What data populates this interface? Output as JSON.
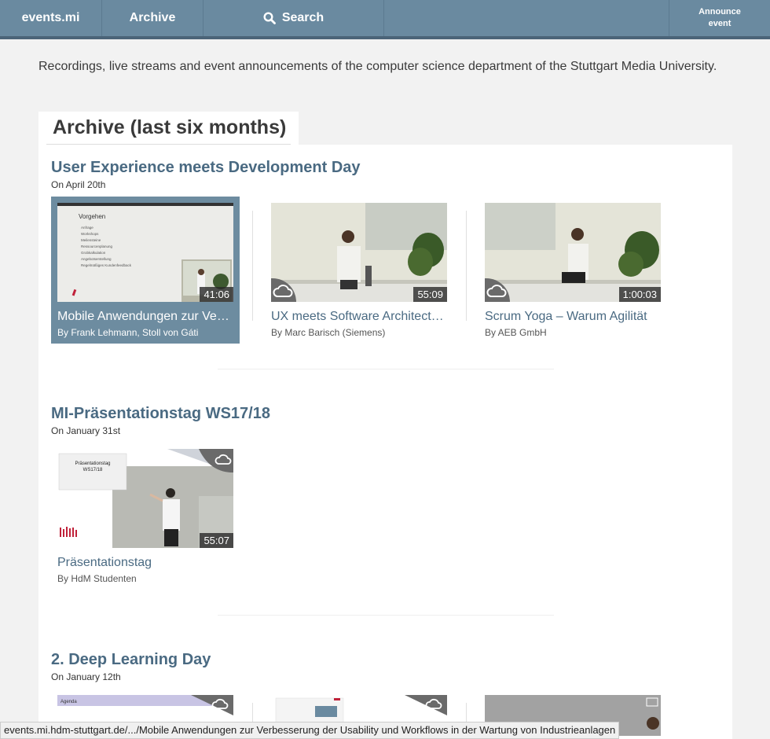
{
  "nav": {
    "brand": "events.mi",
    "archive": "Archive",
    "search": "Search",
    "announce_line1": "Announce",
    "announce_line2": "event"
  },
  "intro": "Recordings, live streams and event announcements of the computer science department of the Stuttgart Media University.",
  "archive_heading": "Archive (last six months)",
  "events": [
    {
      "title": "User Experience meets Development Day",
      "date": "On April 20th",
      "videos": [
        {
          "title": "Mobile Anwendungen zur Verbesserung der Usability und Workflows in der Wartung von Industrieanlagen",
          "by": "By Frank Lehmann, Stoll von Gáti",
          "duration": "41:06",
          "slide_title": "Vorgehen",
          "slide_bullets": [
            "Anfrage",
            "Workshops",
            "Meilensteine",
            "Ressourcenplanung",
            "Grobkalkulation",
            "Angebotserstellung",
            "Regelmäßiges Kundenfeedback"
          ]
        },
        {
          "title": "UX meets Software Architecture",
          "by": "By Marc Barisch (Siemens)",
          "duration": "55:09"
        },
        {
          "title": "Scrum Yoga – Warum Agilität",
          "by": "By AEB GmbH",
          "duration": "1:00:03"
        }
      ]
    },
    {
      "title": "MI-Präsentationstag WS17/18",
      "date": "On January 31st",
      "videos": [
        {
          "title": "Präsentationstag",
          "by": "By HdM Studenten",
          "duration": "55:07",
          "slide_title_1": "Präsentationstag",
          "slide_title_2": "WS17/18"
        }
      ]
    },
    {
      "title": "2. Deep Learning Day",
      "date": "On January 12th",
      "videos": [
        {
          "slide_title": "Agenda"
        },
        {},
        {}
      ]
    }
  ],
  "statusbar": "events.mi.hdm-stuttgart.de/.../Mobile Anwendungen zur Verbesserung der Usability und Workflows in der Wartung von Industrieanlagen",
  "colors": {
    "nav": "#6a8aa0",
    "accent": "#4a6a82",
    "selected": "#6d8ca0"
  }
}
